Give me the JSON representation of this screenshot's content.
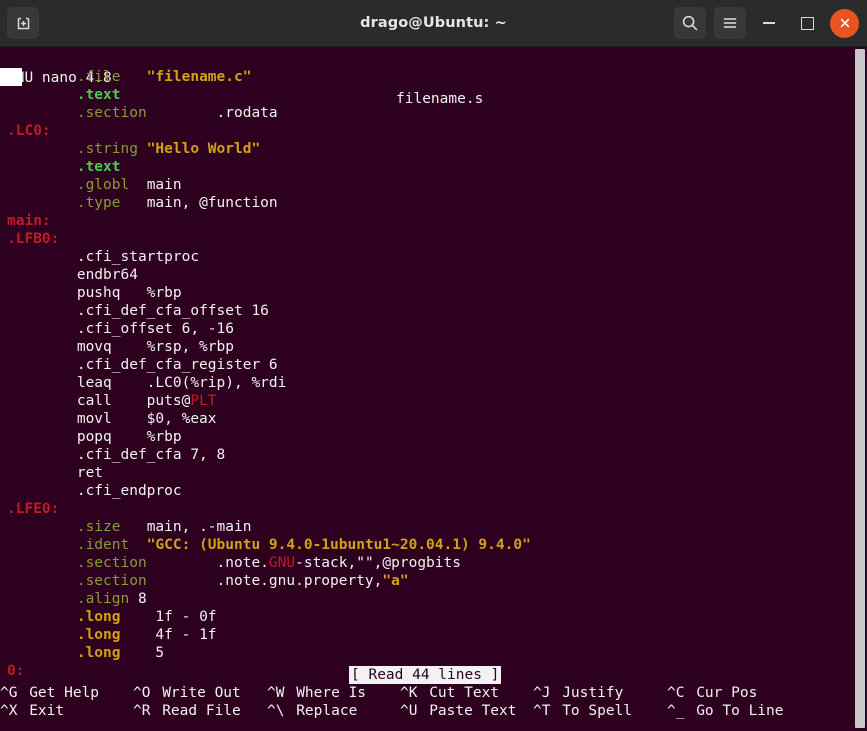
{
  "window": {
    "title": "drago@Ubuntu: ~",
    "new_tab_icon": "new-tab-icon",
    "search_icon": "search-icon",
    "menu_icon": "hamburger-menu-icon",
    "minimize_label": "minimize-icon",
    "maximize_label": "maximize-icon",
    "close_label": "close-icon",
    "accent_color": "#e95420",
    "titlebar_color": "#2b2b2b",
    "terminal_bg": "#2c001e"
  },
  "editor": {
    "version": "GNU nano 4.8",
    "filename": "filename.s",
    "status_message": "[ Read 44 lines ]",
    "colors": {
      "label": "#c01c28",
      "directive_dim": "#8a9a3a",
      "directive_bright": "#4ec94e",
      "string": "#d4a017",
      "plain": "#f2f2f2"
    },
    "lines": [
      {
        "indent": "        ",
        "parts": [
          {
            "t": ".file",
            "c": "dim"
          },
          {
            "t": "   ",
            "c": "plain"
          },
          {
            "t": "\"filename.c\"",
            "c": "gold"
          }
        ]
      },
      {
        "indent": "        ",
        "parts": [
          {
            "t": ".text",
            "c": "green"
          }
        ]
      },
      {
        "indent": "        ",
        "parts": [
          {
            "t": ".section",
            "c": "dim"
          },
          {
            "t": "        .rodata",
            "c": "plain"
          }
        ]
      },
      {
        "indent": "",
        "parts": [
          {
            "t": ".LC0:",
            "c": "label"
          }
        ]
      },
      {
        "indent": "        ",
        "parts": [
          {
            "t": ".string",
            "c": "dim"
          },
          {
            "t": " ",
            "c": "plain"
          },
          {
            "t": "\"Hello World\"",
            "c": "gold"
          }
        ]
      },
      {
        "indent": "        ",
        "parts": [
          {
            "t": ".text",
            "c": "green"
          }
        ]
      },
      {
        "indent": "        ",
        "parts": [
          {
            "t": ".globl",
            "c": "dim"
          },
          {
            "t": "  main",
            "c": "plain"
          }
        ]
      },
      {
        "indent": "        ",
        "parts": [
          {
            "t": ".type",
            "c": "dim"
          },
          {
            "t": "   main, @function",
            "c": "plain"
          }
        ]
      },
      {
        "indent": "",
        "parts": [
          {
            "t": "main:",
            "c": "label"
          }
        ]
      },
      {
        "indent": "",
        "parts": [
          {
            "t": ".LFB0:",
            "c": "label"
          }
        ]
      },
      {
        "indent": "        ",
        "parts": [
          {
            "t": ".cfi_startproc",
            "c": "plain"
          }
        ]
      },
      {
        "indent": "        ",
        "parts": [
          {
            "t": "endbr64",
            "c": "plain"
          }
        ]
      },
      {
        "indent": "        ",
        "parts": [
          {
            "t": "pushq   %rbp",
            "c": "plain"
          }
        ]
      },
      {
        "indent": "        ",
        "parts": [
          {
            "t": ".cfi_def_cfa_offset 16",
            "c": "plain"
          }
        ]
      },
      {
        "indent": "        ",
        "parts": [
          {
            "t": ".cfi_offset 6, -16",
            "c": "plain"
          }
        ]
      },
      {
        "indent": "        ",
        "parts": [
          {
            "t": "movq    %rsp, %rbp",
            "c": "plain"
          }
        ]
      },
      {
        "indent": "        ",
        "parts": [
          {
            "t": ".cfi_def_cfa_register 6",
            "c": "plain"
          }
        ]
      },
      {
        "indent": "        ",
        "parts": [
          {
            "t": "leaq    .LC0(%rip), %rdi",
            "c": "plain"
          }
        ]
      },
      {
        "indent": "        ",
        "parts": [
          {
            "t": "call    puts@",
            "c": "plain"
          },
          {
            "t": "PLT",
            "c": "red"
          }
        ]
      },
      {
        "indent": "        ",
        "parts": [
          {
            "t": "movl    $0, %eax",
            "c": "plain"
          }
        ]
      },
      {
        "indent": "        ",
        "parts": [
          {
            "t": "popq    %rbp",
            "c": "plain"
          }
        ]
      },
      {
        "indent": "        ",
        "parts": [
          {
            "t": ".cfi_def_cfa 7, 8",
            "c": "plain"
          }
        ]
      },
      {
        "indent": "        ",
        "parts": [
          {
            "t": "ret",
            "c": "plain"
          }
        ]
      },
      {
        "indent": "        ",
        "parts": [
          {
            "t": ".cfi_endproc",
            "c": "plain"
          }
        ]
      },
      {
        "indent": "",
        "parts": [
          {
            "t": ".LFE0:",
            "c": "label"
          }
        ]
      },
      {
        "indent": "        ",
        "parts": [
          {
            "t": ".size",
            "c": "dim"
          },
          {
            "t": "   main, .-main",
            "c": "plain"
          }
        ]
      },
      {
        "indent": "        ",
        "parts": [
          {
            "t": ".ident",
            "c": "dim"
          },
          {
            "t": "  ",
            "c": "plain"
          },
          {
            "t": "\"GCC: (Ubuntu 9.4.0-1ubuntu1~20.04.1) 9.4.0\"",
            "c": "gold"
          }
        ]
      },
      {
        "indent": "        ",
        "parts": [
          {
            "t": ".section",
            "c": "dim"
          },
          {
            "t": "        .note.",
            "c": "plain"
          },
          {
            "t": "GNU",
            "c": "red"
          },
          {
            "t": "-stack,\"\",@progbits",
            "c": "plain"
          }
        ]
      },
      {
        "indent": "        ",
        "parts": [
          {
            "t": ".section",
            "c": "dim"
          },
          {
            "t": "        .note.gnu.property,",
            "c": "plain"
          },
          {
            "t": "\"a\"",
            "c": "gold"
          }
        ]
      },
      {
        "indent": "        ",
        "parts": [
          {
            "t": ".align",
            "c": "dim"
          },
          {
            "t": " 8",
            "c": "plain"
          }
        ]
      },
      {
        "indent": "        ",
        "parts": [
          {
            "t": ".long",
            "c": "gold"
          },
          {
            "t": "    1f - 0f",
            "c": "plain"
          }
        ]
      },
      {
        "indent": "        ",
        "parts": [
          {
            "t": ".long",
            "c": "gold"
          },
          {
            "t": "    4f - 1f",
            "c": "plain"
          }
        ]
      },
      {
        "indent": "        ",
        "parts": [
          {
            "t": ".long",
            "c": "gold"
          },
          {
            "t": "    5",
            "c": "plain"
          }
        ]
      },
      {
        "indent": "",
        "parts": [
          {
            "t": "0:",
            "c": "label"
          }
        ]
      }
    ]
  },
  "shortcuts": {
    "row1": [
      {
        "key": "^G",
        "label": "Get Help"
      },
      {
        "key": "^O",
        "label": "Write Out"
      },
      {
        "key": "^W",
        "label": "Where Is"
      },
      {
        "key": "^K",
        "label": "Cut Text"
      },
      {
        "key": "^J",
        "label": "Justify"
      },
      {
        "key": "^C",
        "label": "Cur Pos"
      }
    ],
    "row2": [
      {
        "key": "^X",
        "label": "Exit"
      },
      {
        "key": "^R",
        "label": "Read File"
      },
      {
        "key": "^\\",
        "label": "Replace"
      },
      {
        "key": "^U",
        "label": "Paste Text"
      },
      {
        "key": "^T",
        "label": "To Spell"
      },
      {
        "key": "^_",
        "label": "Go To Line"
      }
    ]
  }
}
